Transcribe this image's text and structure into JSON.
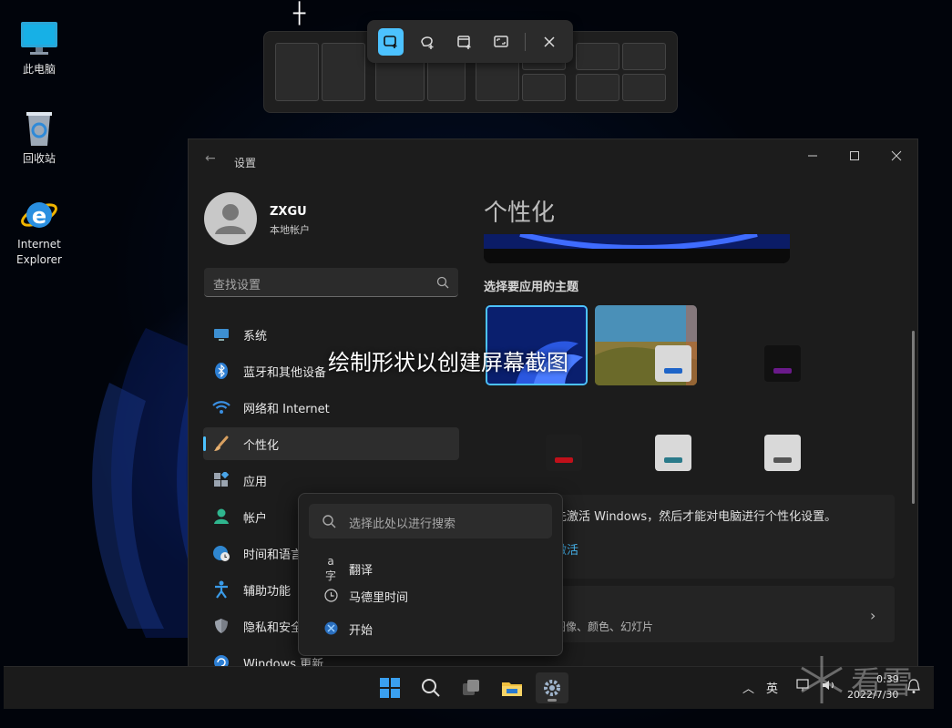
{
  "desktop": {
    "icons": [
      {
        "label": "此电脑"
      },
      {
        "label": "回收站"
      },
      {
        "label": "Internet Explorer"
      }
    ]
  },
  "snip_toolbar": {
    "modes": [
      "rectangle-snip",
      "freeform-snip",
      "window-snip",
      "fullscreen-snip"
    ],
    "active_mode": "rectangle-snip",
    "close": "close"
  },
  "overlay": {
    "caption": "绘制形状以创建屏幕截图"
  },
  "settings": {
    "window_title": "设置",
    "user": {
      "name": "ZXGU",
      "account_type": "本地帐户"
    },
    "search": {
      "placeholder": "查找设置"
    },
    "nav": [
      {
        "label": "系统",
        "icon": "monitor-icon"
      },
      {
        "label": "蓝牙和其他设备",
        "icon": "bluetooth-icon"
      },
      {
        "label": "网络和 Internet",
        "icon": "wifi-icon"
      },
      {
        "label": "个性化",
        "icon": "brush-icon",
        "selected": true
      },
      {
        "label": "应用",
        "icon": "apps-icon"
      },
      {
        "label": "帐户",
        "icon": "person-icon"
      },
      {
        "label": "时间和语言",
        "icon": "globe-clock-icon"
      },
      {
        "label": "辅助功能",
        "icon": "accessibility-icon"
      },
      {
        "label": "隐私和安全性",
        "icon": "shield-icon"
      },
      {
        "label": "Windows 更新",
        "icon": "update-icon"
      }
    ],
    "page_title": "个性化",
    "theme_section_label": "选择要应用的主题",
    "activation_notice": "先激活 Windows，然后才能对电脑进行个性化设置。",
    "activation_link": "激活",
    "background_subtitle": "图像、颜色、幻灯片",
    "colors": {
      "accent": "#4cc2ff",
      "window_bg": "#1c1c1c"
    }
  },
  "search_flyout": {
    "placeholder": "选择此处以进行搜索",
    "items": [
      {
        "label": "翻译",
        "icon": "translate-icon"
      },
      {
        "label": "马德里时间",
        "icon": "clock-icon"
      },
      {
        "label": "开始",
        "icon": "start-icon"
      }
    ]
  },
  "taskbar": {
    "apps": [
      "start-icon",
      "search-icon",
      "task-view-icon",
      "file-explorer-icon",
      "settings-icon"
    ],
    "tray": {
      "ime": "英",
      "time": "0:39",
      "date": "2022/7/30"
    }
  },
  "watermark": {
    "text": "看雪"
  }
}
